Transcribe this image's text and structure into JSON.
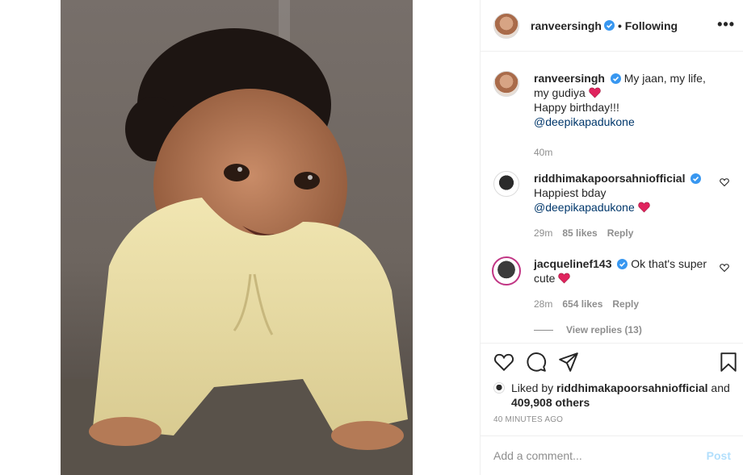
{
  "post": {
    "author": "ranveersingh",
    "following_label": "• Following",
    "more_label": "•••",
    "caption": {
      "username": "ranveersingh",
      "line1": "My jaan, my life, my gudiya",
      "line2": "Happy birthday!!!",
      "mention": "@deepikapadukone",
      "time": "40m"
    },
    "comments": [
      {
        "username": "riddhimakapoorsahniofficial",
        "text": "Happiest bday",
        "mention": "@deepikapadukone",
        "time": "29m",
        "likes": "85 likes",
        "reply": "Reply"
      },
      {
        "username": "jacquelinef143",
        "text": "Ok that's super cute",
        "time": "28m",
        "likes": "654 likes",
        "reply": "Reply"
      }
    ],
    "view_replies": "View replies (13)",
    "liked_by": {
      "prefix": "Liked by",
      "user": "riddhimakapoorsahniofficial",
      "and": "and",
      "others": "409,908 others"
    },
    "timestamp": "40 MINUTES AGO",
    "add_comment": {
      "placeholder": "Add a comment...",
      "post_label": "Post"
    }
  },
  "icons": {
    "like": "heart-icon",
    "comment": "comment-icon",
    "share": "share-icon",
    "save": "bookmark-icon",
    "verified": "verified-badge-icon",
    "more": "more-dots-icon"
  },
  "colors": {
    "verified": "#3897f0",
    "mention": "#00376b",
    "muted": "#8e8e8e",
    "post_disabled": "#b2dffc",
    "heart_emoji": "#e0245e"
  }
}
